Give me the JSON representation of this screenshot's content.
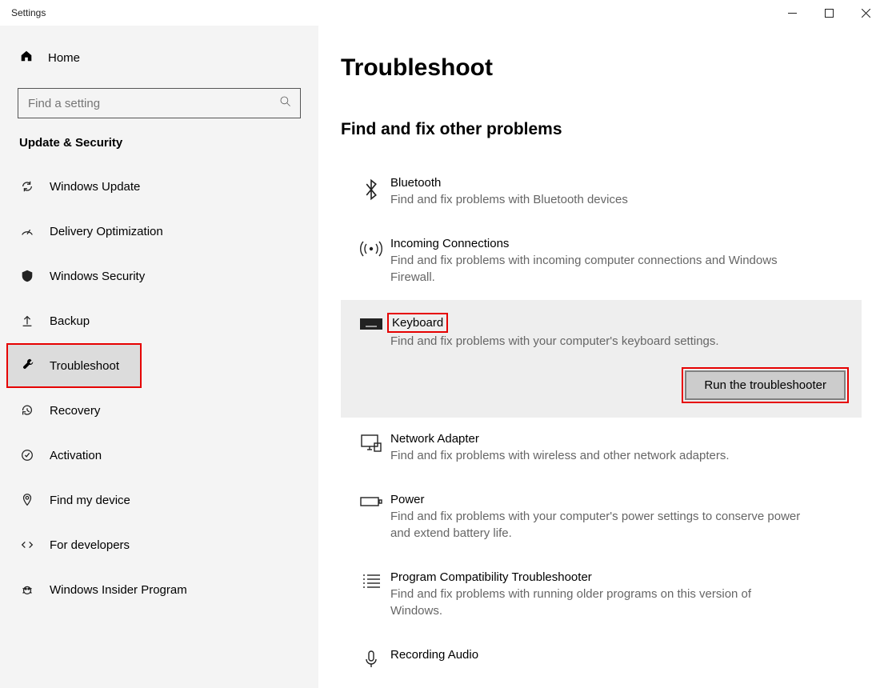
{
  "window": {
    "title": "Settings"
  },
  "sidebar": {
    "home": "Home",
    "search_placeholder": "Find a setting",
    "category": "Update & Security",
    "items": [
      {
        "id": "windows-update",
        "label": "Windows Update"
      },
      {
        "id": "delivery-optimization",
        "label": "Delivery Optimization"
      },
      {
        "id": "windows-security",
        "label": "Windows Security"
      },
      {
        "id": "backup",
        "label": "Backup"
      },
      {
        "id": "troubleshoot",
        "label": "Troubleshoot",
        "selected": true,
        "highlighted": true
      },
      {
        "id": "recovery",
        "label": "Recovery"
      },
      {
        "id": "activation",
        "label": "Activation"
      },
      {
        "id": "find-my-device",
        "label": "Find my device"
      },
      {
        "id": "for-developers",
        "label": "For developers"
      },
      {
        "id": "windows-insider",
        "label": "Windows Insider Program"
      }
    ]
  },
  "main": {
    "title": "Troubleshoot",
    "section": "Find and fix other problems",
    "items": [
      {
        "id": "bluetooth",
        "title": "Bluetooth",
        "desc": "Find and fix problems with Bluetooth devices"
      },
      {
        "id": "incoming",
        "title": "Incoming Connections",
        "desc": "Find and fix problems with incoming computer connections and Windows Firewall."
      },
      {
        "id": "keyboard",
        "title": "Keyboard",
        "desc": "Find and fix problems with your computer's keyboard settings.",
        "expanded": true,
        "highlighted": true,
        "action": "Run the troubleshooter"
      },
      {
        "id": "network",
        "title": "Network Adapter",
        "desc": "Find and fix problems with wireless and other network adapters."
      },
      {
        "id": "power",
        "title": "Power",
        "desc": "Find and fix problems with your computer's power settings to conserve power and extend battery life."
      },
      {
        "id": "compat",
        "title": "Program Compatibility Troubleshooter",
        "desc": "Find and fix problems with running older programs on this version of Windows."
      },
      {
        "id": "audio",
        "title": "Recording Audio",
        "desc": ""
      }
    ]
  }
}
